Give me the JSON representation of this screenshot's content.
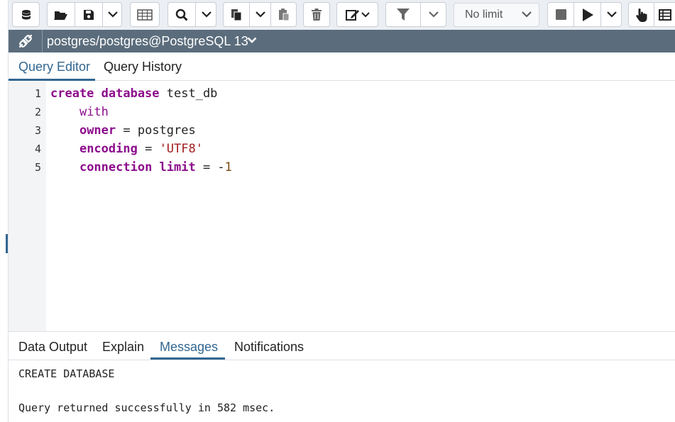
{
  "toolbar": {
    "limit_select": {
      "selected": "No limit"
    }
  },
  "connection": {
    "title": "postgres/postgres@PostgreSQL 13"
  },
  "editor_tabs": [
    {
      "label": "Query Editor",
      "active": true
    },
    {
      "label": "Query History",
      "active": false
    }
  ],
  "editor": {
    "line_numbers": [
      "1",
      "2",
      "3",
      "4",
      "5"
    ],
    "lines": [
      {
        "kw": "create database",
        "rest": " test_db"
      },
      {
        "indent": "    ",
        "kw": "with"
      },
      {
        "indent": "    ",
        "kw": "owner",
        "rest": " = postgres"
      },
      {
        "indent": "    ",
        "kw": "encoding",
        "op": " = ",
        "str": "'UTF8'"
      },
      {
        "indent": "    ",
        "kw": "connection limit",
        "op": " = -",
        "num": "1"
      }
    ]
  },
  "result_tabs": [
    {
      "label": "Data Output",
      "active": false
    },
    {
      "label": "Explain",
      "active": false
    },
    {
      "label": "Messages",
      "active": true
    },
    {
      "label": "Notifications",
      "active": false
    }
  ],
  "messages": {
    "line1": "CREATE DATABASE",
    "line2": "Query returned successfully in 582 msec."
  },
  "colors": {
    "accent": "#326690",
    "connection_bar": "#5b6d7c",
    "keyword": "#8c0c8c",
    "string": "#a11d1d"
  }
}
